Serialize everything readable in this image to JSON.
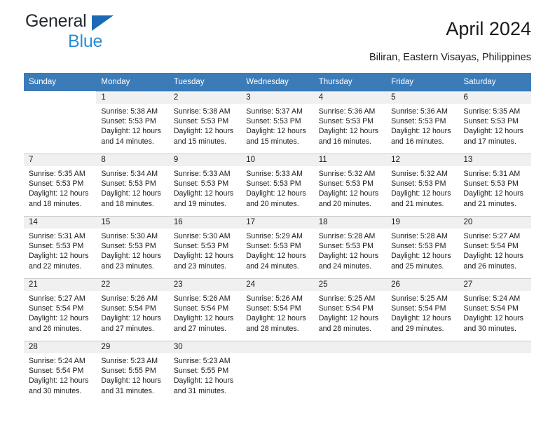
{
  "brand": {
    "name_top": "General",
    "name_bottom": "Blue",
    "accent_color": "#2a8cd6",
    "triangle_color": "#1b6ab3"
  },
  "header": {
    "title": "April 2024",
    "subtitle": "Biliran, Eastern Visayas, Philippines"
  },
  "theme": {
    "header_row_bg": "#3b7cb8",
    "daynum_bg": "#f0f0f0",
    "grid_line": "#c8c8c8"
  },
  "weekday_headers": [
    "Sunday",
    "Monday",
    "Tuesday",
    "Wednesday",
    "Thursday",
    "Friday",
    "Saturday"
  ],
  "labels": {
    "sunrise_prefix": "Sunrise:",
    "sunset_prefix": "Sunset:",
    "daylight_prefix": "Daylight:"
  },
  "weeks": [
    [
      {
        "day": "",
        "empty": true
      },
      {
        "day": "1",
        "sunrise": "Sunrise: 5:38 AM",
        "sunset": "Sunset: 5:53 PM",
        "daylight1": "Daylight: 12 hours",
        "daylight2": "and 14 minutes."
      },
      {
        "day": "2",
        "sunrise": "Sunrise: 5:38 AM",
        "sunset": "Sunset: 5:53 PM",
        "daylight1": "Daylight: 12 hours",
        "daylight2": "and 15 minutes."
      },
      {
        "day": "3",
        "sunrise": "Sunrise: 5:37 AM",
        "sunset": "Sunset: 5:53 PM",
        "daylight1": "Daylight: 12 hours",
        "daylight2": "and 15 minutes."
      },
      {
        "day": "4",
        "sunrise": "Sunrise: 5:36 AM",
        "sunset": "Sunset: 5:53 PM",
        "daylight1": "Daylight: 12 hours",
        "daylight2": "and 16 minutes."
      },
      {
        "day": "5",
        "sunrise": "Sunrise: 5:36 AM",
        "sunset": "Sunset: 5:53 PM",
        "daylight1": "Daylight: 12 hours",
        "daylight2": "and 16 minutes."
      },
      {
        "day": "6",
        "sunrise": "Sunrise: 5:35 AM",
        "sunset": "Sunset: 5:53 PM",
        "daylight1": "Daylight: 12 hours",
        "daylight2": "and 17 minutes."
      }
    ],
    [
      {
        "day": "7",
        "sunrise": "Sunrise: 5:35 AM",
        "sunset": "Sunset: 5:53 PM",
        "daylight1": "Daylight: 12 hours",
        "daylight2": "and 18 minutes."
      },
      {
        "day": "8",
        "sunrise": "Sunrise: 5:34 AM",
        "sunset": "Sunset: 5:53 PM",
        "daylight1": "Daylight: 12 hours",
        "daylight2": "and 18 minutes."
      },
      {
        "day": "9",
        "sunrise": "Sunrise: 5:33 AM",
        "sunset": "Sunset: 5:53 PM",
        "daylight1": "Daylight: 12 hours",
        "daylight2": "and 19 minutes."
      },
      {
        "day": "10",
        "sunrise": "Sunrise: 5:33 AM",
        "sunset": "Sunset: 5:53 PM",
        "daylight1": "Daylight: 12 hours",
        "daylight2": "and 20 minutes."
      },
      {
        "day": "11",
        "sunrise": "Sunrise: 5:32 AM",
        "sunset": "Sunset: 5:53 PM",
        "daylight1": "Daylight: 12 hours",
        "daylight2": "and 20 minutes."
      },
      {
        "day": "12",
        "sunrise": "Sunrise: 5:32 AM",
        "sunset": "Sunset: 5:53 PM",
        "daylight1": "Daylight: 12 hours",
        "daylight2": "and 21 minutes."
      },
      {
        "day": "13",
        "sunrise": "Sunrise: 5:31 AM",
        "sunset": "Sunset: 5:53 PM",
        "daylight1": "Daylight: 12 hours",
        "daylight2": "and 21 minutes."
      }
    ],
    [
      {
        "day": "14",
        "sunrise": "Sunrise: 5:31 AM",
        "sunset": "Sunset: 5:53 PM",
        "daylight1": "Daylight: 12 hours",
        "daylight2": "and 22 minutes."
      },
      {
        "day": "15",
        "sunrise": "Sunrise: 5:30 AM",
        "sunset": "Sunset: 5:53 PM",
        "daylight1": "Daylight: 12 hours",
        "daylight2": "and 23 minutes."
      },
      {
        "day": "16",
        "sunrise": "Sunrise: 5:30 AM",
        "sunset": "Sunset: 5:53 PM",
        "daylight1": "Daylight: 12 hours",
        "daylight2": "and 23 minutes."
      },
      {
        "day": "17",
        "sunrise": "Sunrise: 5:29 AM",
        "sunset": "Sunset: 5:53 PM",
        "daylight1": "Daylight: 12 hours",
        "daylight2": "and 24 minutes."
      },
      {
        "day": "18",
        "sunrise": "Sunrise: 5:28 AM",
        "sunset": "Sunset: 5:53 PM",
        "daylight1": "Daylight: 12 hours",
        "daylight2": "and 24 minutes."
      },
      {
        "day": "19",
        "sunrise": "Sunrise: 5:28 AM",
        "sunset": "Sunset: 5:53 PM",
        "daylight1": "Daylight: 12 hours",
        "daylight2": "and 25 minutes."
      },
      {
        "day": "20",
        "sunrise": "Sunrise: 5:27 AM",
        "sunset": "Sunset: 5:54 PM",
        "daylight1": "Daylight: 12 hours",
        "daylight2": "and 26 minutes."
      }
    ],
    [
      {
        "day": "21",
        "sunrise": "Sunrise: 5:27 AM",
        "sunset": "Sunset: 5:54 PM",
        "daylight1": "Daylight: 12 hours",
        "daylight2": "and 26 minutes."
      },
      {
        "day": "22",
        "sunrise": "Sunrise: 5:26 AM",
        "sunset": "Sunset: 5:54 PM",
        "daylight1": "Daylight: 12 hours",
        "daylight2": "and 27 minutes."
      },
      {
        "day": "23",
        "sunrise": "Sunrise: 5:26 AM",
        "sunset": "Sunset: 5:54 PM",
        "daylight1": "Daylight: 12 hours",
        "daylight2": "and 27 minutes."
      },
      {
        "day": "24",
        "sunrise": "Sunrise: 5:26 AM",
        "sunset": "Sunset: 5:54 PM",
        "daylight1": "Daylight: 12 hours",
        "daylight2": "and 28 minutes."
      },
      {
        "day": "25",
        "sunrise": "Sunrise: 5:25 AM",
        "sunset": "Sunset: 5:54 PM",
        "daylight1": "Daylight: 12 hours",
        "daylight2": "and 28 minutes."
      },
      {
        "day": "26",
        "sunrise": "Sunrise: 5:25 AM",
        "sunset": "Sunset: 5:54 PM",
        "daylight1": "Daylight: 12 hours",
        "daylight2": "and 29 minutes."
      },
      {
        "day": "27",
        "sunrise": "Sunrise: 5:24 AM",
        "sunset": "Sunset: 5:54 PM",
        "daylight1": "Daylight: 12 hours",
        "daylight2": "and 30 minutes."
      }
    ],
    [
      {
        "day": "28",
        "sunrise": "Sunrise: 5:24 AM",
        "sunset": "Sunset: 5:54 PM",
        "daylight1": "Daylight: 12 hours",
        "daylight2": "and 30 minutes."
      },
      {
        "day": "29",
        "sunrise": "Sunrise: 5:23 AM",
        "sunset": "Sunset: 5:55 PM",
        "daylight1": "Daylight: 12 hours",
        "daylight2": "and 31 minutes."
      },
      {
        "day": "30",
        "sunrise": "Sunrise: 5:23 AM",
        "sunset": "Sunset: 5:55 PM",
        "daylight1": "Daylight: 12 hours",
        "daylight2": "and 31 minutes."
      },
      {
        "day": "",
        "blank": true
      },
      {
        "day": "",
        "blank": true
      },
      {
        "day": "",
        "blank": true
      },
      {
        "day": "",
        "blank": true
      }
    ]
  ]
}
